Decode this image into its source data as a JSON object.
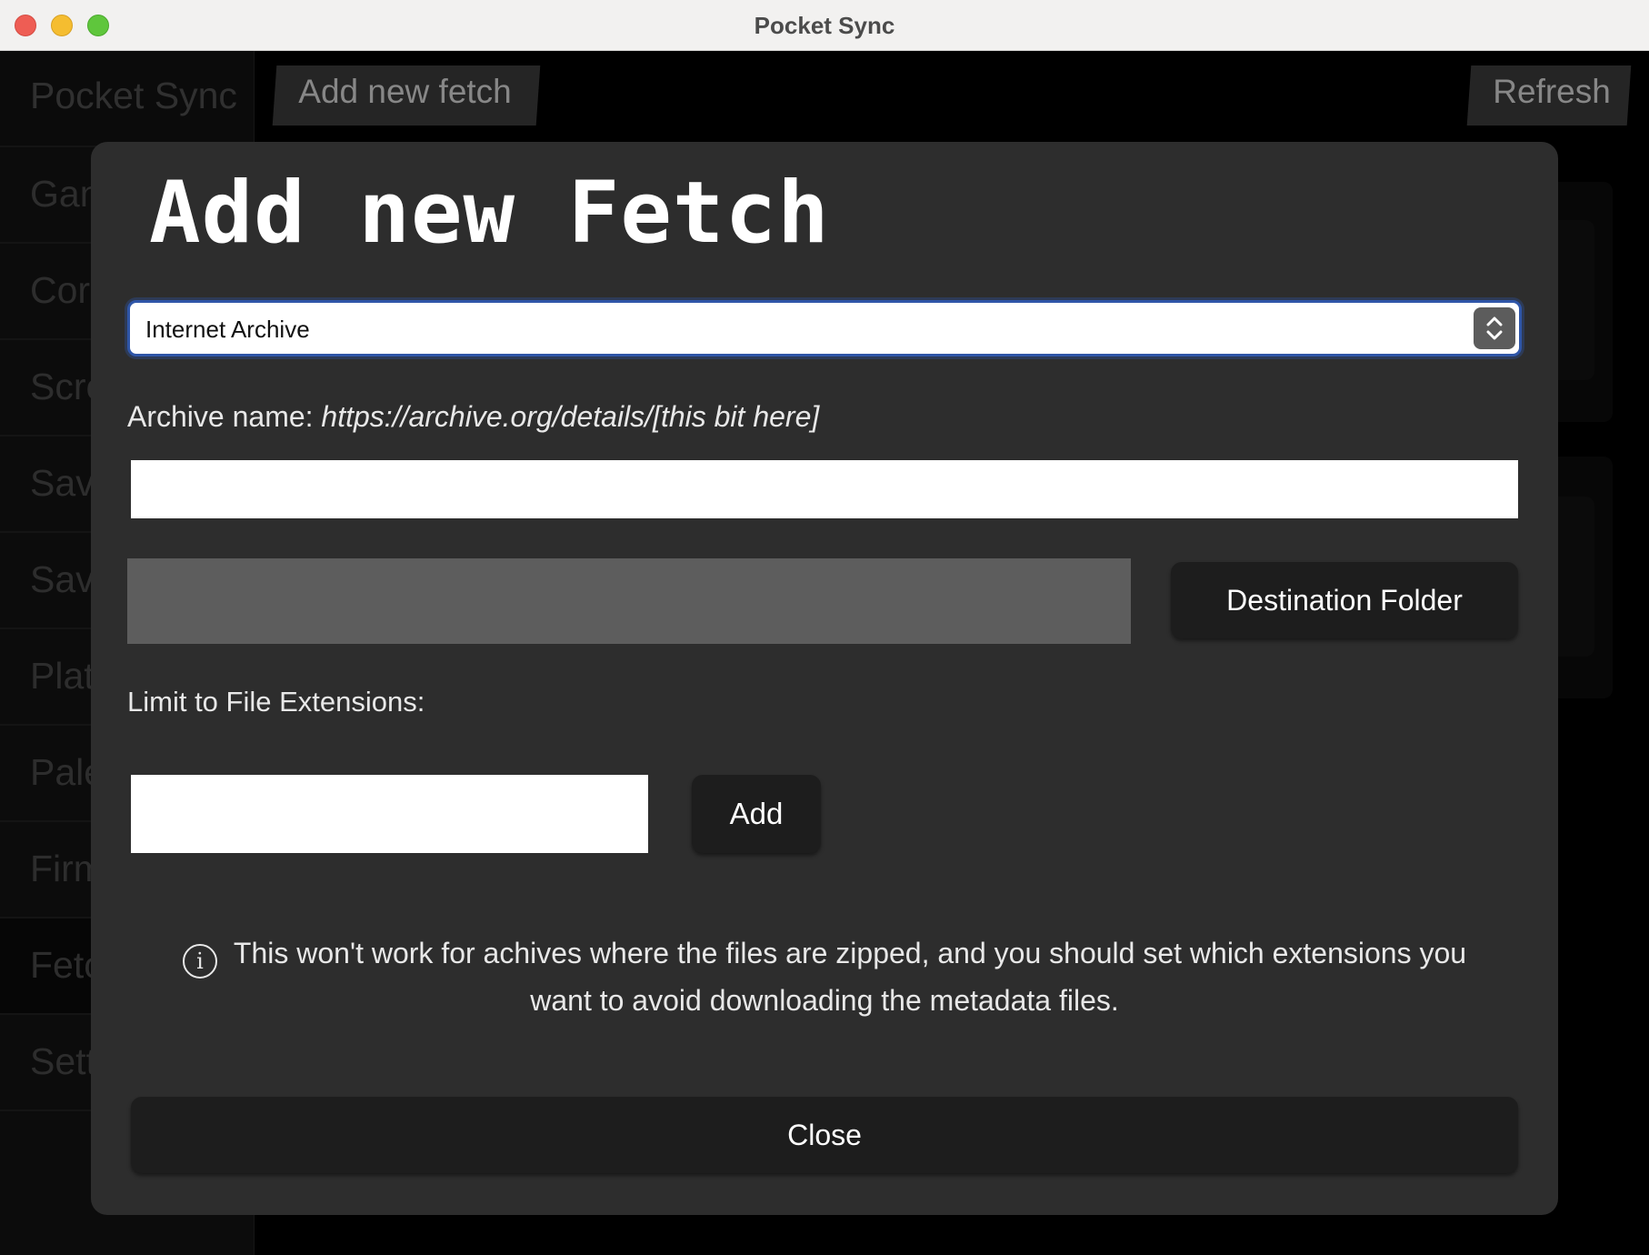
{
  "window": {
    "title": "Pocket Sync"
  },
  "sidebar": {
    "title": "Pocket Sync",
    "items": [
      {
        "label": "Gan"
      },
      {
        "label": "Cor"
      },
      {
        "label": "Scre"
      },
      {
        "label": "Sav"
      },
      {
        "label": "Sav"
      },
      {
        "label": "Plat"
      },
      {
        "label": "Pale"
      },
      {
        "label": "Firm"
      },
      {
        "label": "Fetc"
      },
      {
        "label": "Sett"
      }
    ]
  },
  "toolbar": {
    "add_label": "Add new fetch",
    "refresh_label": "Refresh"
  },
  "modal": {
    "title": "Add new Fetch",
    "source_select": {
      "value": "Internet Archive"
    },
    "archive_label_prefix": "Archive name:",
    "archive_label_hint": "https://archive.org/details/[this bit here]",
    "archive_input_value": "",
    "destination_button": "Destination Folder",
    "extensions_label": "Limit to File Extensions:",
    "extension_input_value": "",
    "add_button": "Add",
    "info_text": "This won't work for achives where the files are zipped, and you should set which extensions you want to avoid downloading the metadata files.",
    "close_button": "Close"
  }
}
